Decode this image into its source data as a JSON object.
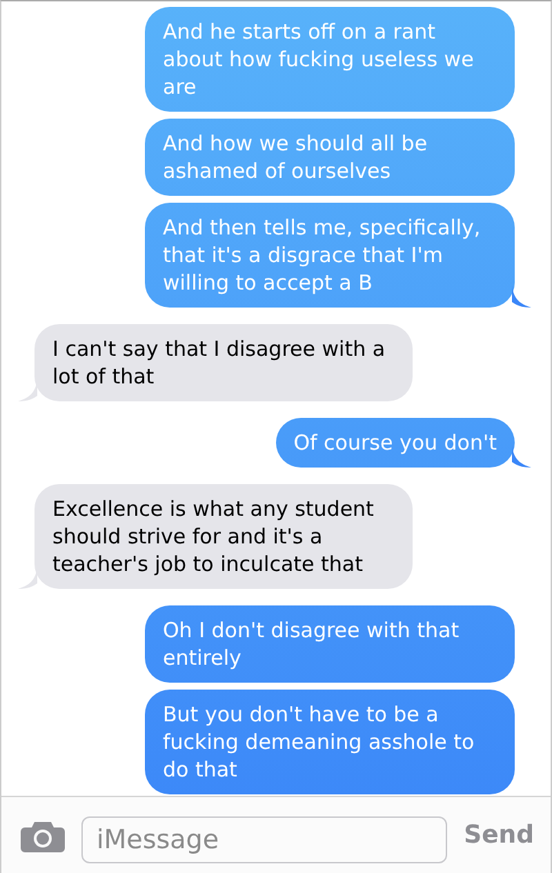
{
  "messages": [
    {
      "kind": "sent",
      "text": "And he starts off on a rant about how fucking useless we are",
      "tail": false
    },
    {
      "kind": "sent",
      "text": "And how we should all be ashamed of ourselves",
      "tail": false
    },
    {
      "kind": "sent",
      "text": "And then tells me, specifically, that it's a disgrace that I'm willing to accept a B",
      "tail": true
    },
    {
      "kind": "received",
      "text": "I can't say that I disagree with a lot of that",
      "tail": true
    },
    {
      "kind": "sent",
      "text": "Of course you don't",
      "tail": true
    },
    {
      "kind": "received",
      "text": "Excellence is what any student should strive for and it's a teacher's job to inculcate that",
      "tail": true
    },
    {
      "kind": "sent",
      "text": "Oh I don't disagree with that entirely",
      "tail": false
    },
    {
      "kind": "sent",
      "text": "But you don't have to be a fucking demeaning asshole to do that",
      "tail": false
    }
  ],
  "composer": {
    "placeholder": "iMessage",
    "send_label": "Send"
  }
}
